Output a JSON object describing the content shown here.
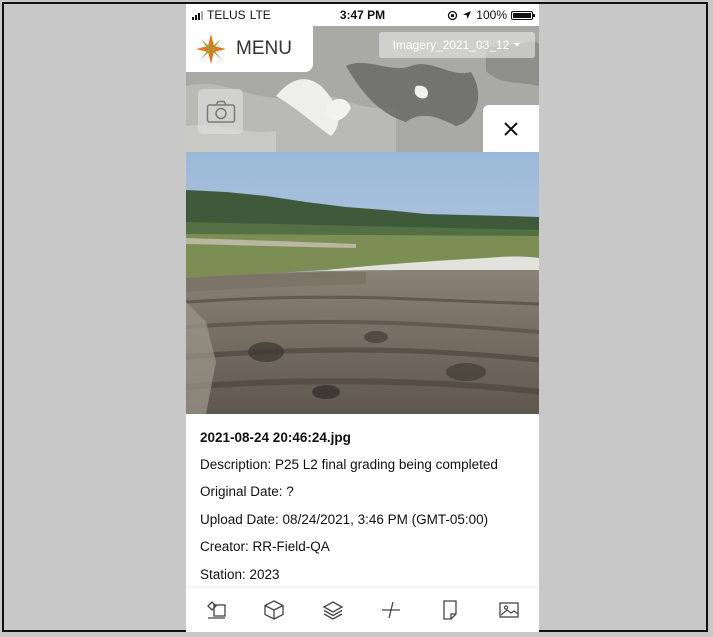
{
  "status_bar": {
    "carrier": "TELUS",
    "network": "LTE",
    "time": "3:47 PM",
    "battery": "100%"
  },
  "map": {
    "menu_label": "MENU",
    "imagery_selector": "Imagery_2021_03_12"
  },
  "photo": {
    "filename": "2021-08-24 20:46:24.jpg",
    "description": "Description: P25 L2 final grading being completed",
    "original_date": "Original Date: ?",
    "upload_date": "Upload Date: 08/24/2021, 3:46 PM (GMT-05:00)",
    "creator": "Creator: RR-Field-QA",
    "station": "Station: 2023"
  },
  "toolbar": {
    "icons": [
      "measure-tool-icon",
      "3d-cube-icon",
      "layers-icon",
      "split-compare-icon",
      "page-icon",
      "image-gallery-icon"
    ]
  },
  "colors": {
    "logo_orange": "#e8731c",
    "logo_green": "#7cae3a",
    "accent_dark": "#111111"
  }
}
